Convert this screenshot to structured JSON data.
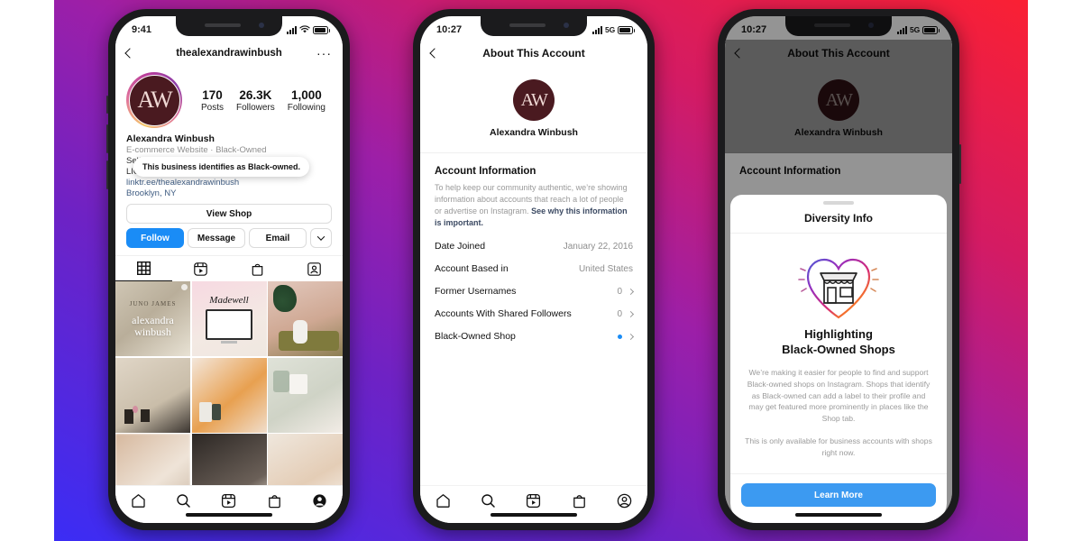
{
  "background": {
    "gradient_from": "#3b2df5",
    "gradient_to": "#fa2033"
  },
  "brand": {
    "accent_blue": "#1a8cf6",
    "avatar_bg": "#4a1a20",
    "avatar_initials": "AW"
  },
  "phone1": {
    "status": {
      "time": "9:41",
      "network": "",
      "icons": [
        "signal-bars",
        "wifi",
        "battery"
      ]
    },
    "nav": {
      "title": "thealexandrawinbush",
      "back": "‹",
      "more": "···"
    },
    "stats": [
      {
        "num": "170",
        "label": "Posts"
      },
      {
        "num": "26.3K",
        "label": "Followers"
      },
      {
        "num": "1,000",
        "label": "Following"
      }
    ],
    "bio": {
      "name": "Alexandra Winbush",
      "category": "E-commerce Website · Black-Owned",
      "line1": "Self",
      "line2": "LIG",
      "link": "linktr.ee/thealexandrawinbush",
      "location": "Brooklyn, NY"
    },
    "tooltip": "This business identifies as Black-owned.",
    "buttons": {
      "view_shop": "View Shop",
      "follow": "Follow",
      "message": "Message",
      "email": "Email",
      "more_caret": "chevron-down"
    },
    "profile_tabs": [
      {
        "name": "grid",
        "active": true
      },
      {
        "name": "reels",
        "active": false
      },
      {
        "name": "shop",
        "active": false
      },
      {
        "name": "tagged",
        "active": false
      }
    ],
    "grid": [
      {
        "caption": "JUNO JAMES — alexandra winbush",
        "type": "photo"
      },
      {
        "caption": "Madewell laptop mockup",
        "type": "photo"
      },
      {
        "caption": "Woman on green sofa with plant",
        "type": "photo"
      },
      {
        "caption": "Interior room with chairs",
        "type": "photo"
      },
      {
        "caption": "Skincare products flatlay",
        "type": "photo"
      },
      {
        "caption": "Candle and glassware",
        "type": "photo"
      },
      {
        "caption": "Blurred warm interior",
        "type": "photo"
      },
      {
        "caption": "Dark table setting",
        "type": "photo"
      },
      {
        "caption": "Neutral textile detail",
        "type": "photo"
      }
    ],
    "tabbar": [
      "home-icon",
      "search-icon",
      "reels-icon",
      "shop-icon",
      "profile-icon"
    ]
  },
  "phone2": {
    "status": {
      "time": "10:27",
      "network": "5G"
    },
    "nav": {
      "title": "About This Account",
      "back": "‹"
    },
    "hero": {
      "name": "Alexandra Winbush"
    },
    "section": {
      "title": "Account Information",
      "description": "To help keep our community authentic, we’re showing information about accounts that reach a lot of people or advertise on Instagram.",
      "link": "See why this information is important."
    },
    "rows": [
      {
        "key": "Date Joined",
        "value": "January 22, 2016",
        "chevron": false,
        "dot": false
      },
      {
        "key": "Account Based in",
        "value": "United States",
        "chevron": false,
        "dot": false
      },
      {
        "key": "Former Usernames",
        "value": "0",
        "chevron": true,
        "dot": false
      },
      {
        "key": "Accounts With Shared Followers",
        "value": "0",
        "chevron": true,
        "dot": false
      },
      {
        "key": "Black-Owned Shop",
        "value": "",
        "chevron": true,
        "dot": true
      }
    ],
    "tabbar": [
      "home-icon",
      "search-icon",
      "reels-icon",
      "shop-icon",
      "profile-icon"
    ]
  },
  "phone3": {
    "status": {
      "time": "10:27",
      "network": "5G"
    },
    "nav": {
      "title": "About This Account",
      "back": "‹"
    },
    "hero": {
      "name": "Alexandra Winbush"
    },
    "section": {
      "title": "Account Information"
    },
    "sheet": {
      "title": "Diversity Info",
      "illustration": "heart-shop-icon",
      "heading_line1": "Highlighting",
      "heading_line2": "Black-Owned Shops",
      "paragraph1": "We’re making it easier for people to find and support Black-owned shops on Instagram. Shops that identify as Black-owned can add a label to their profile and may get featured more prominently in places like the Shop tab.",
      "paragraph2": "This is only available for business accounts with shops right now.",
      "cta": "Learn More"
    }
  }
}
